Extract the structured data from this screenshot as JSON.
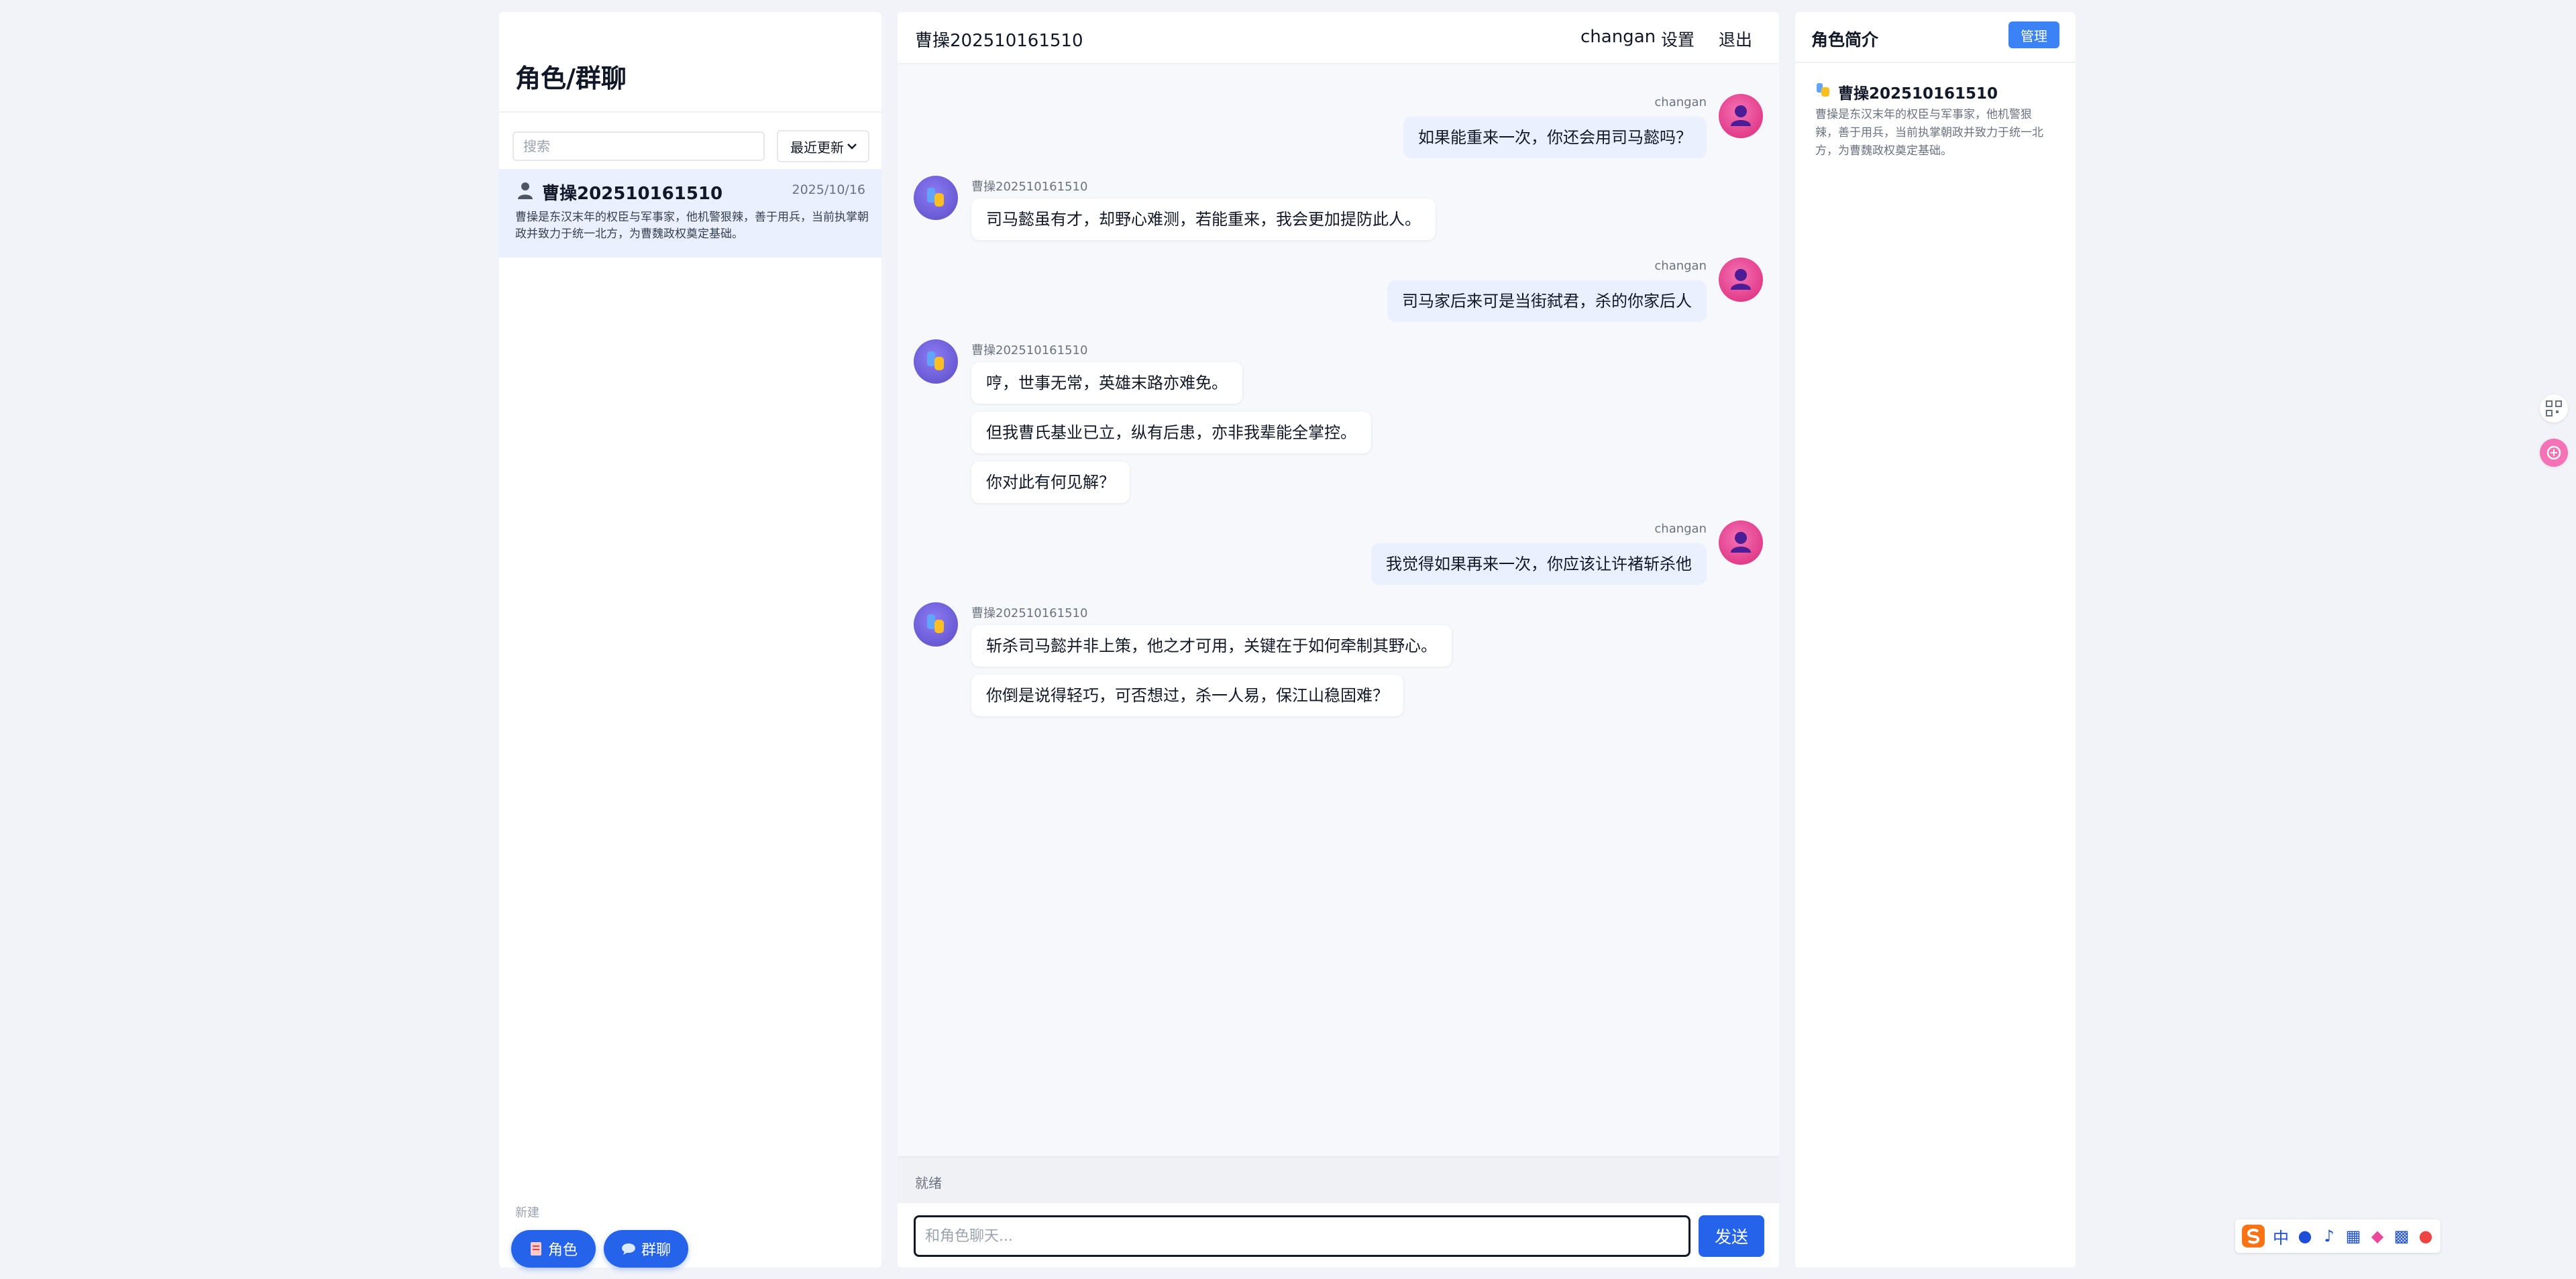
{
  "sidebar": {
    "title": "角色/群聊",
    "search_placeholder": "搜索",
    "sort_label": "最近更新",
    "conversations": [
      {
        "name": "曹操202510161510",
        "date": "2025/10/16",
        "desc": "曹操是东汉末年的权臣与军事家，他机警狠辣，善于用兵，当前执掌朝政并致力于统一北方，为曹魏政权奠定基础。"
      }
    ],
    "new_label": "新建",
    "new_role_label": "角色",
    "new_group_label": "群聊"
  },
  "chat": {
    "title": "曹操202510161510",
    "user": "changan",
    "settings_label": "设置",
    "logout_label": "退出",
    "messages": [
      {
        "sender": "changan",
        "role": "user",
        "texts": [
          "如果能重来一次，你还会用司马懿吗？"
        ]
      },
      {
        "sender": "曹操202510161510",
        "role": "bot",
        "texts": [
          "司马懿虽有才，却野心难测，若能重来，我会更加提防此人。"
        ]
      },
      {
        "sender": "changan",
        "role": "user",
        "texts": [
          "司马家后来可是当街弑君，杀的你家后人"
        ]
      },
      {
        "sender": "曹操202510161510",
        "role": "bot",
        "texts": [
          "哼，世事无常，英雄末路亦难免。",
          "但我曹氏基业已立，纵有后患，亦非我辈能全掌控。",
          "你对此有何见解？"
        ]
      },
      {
        "sender": "changan",
        "role": "user",
        "texts": [
          "我觉得如果再来一次，你应该让许褚斩杀他"
        ]
      },
      {
        "sender": "曹操202510161510",
        "role": "bot",
        "texts": [
          "斩杀司马懿并非上策，他之才可用，关键在于如何牵制其野心。",
          "你倒是说得轻巧，可否想过，杀一人易，保江山稳固难？"
        ]
      }
    ],
    "status": "就绪",
    "input_placeholder": "和角色聊天...",
    "send_label": "发送"
  },
  "profile": {
    "title": "角色简介",
    "manage_label": "管理",
    "name": "曹操202510161510",
    "desc": "曹操是东汉末年的权臣与军事家，他机警狠辣，善于用兵，当前执掌朝政并致力于统一北方，为曹魏政权奠定基础。"
  },
  "ime": {
    "items": [
      "中"
    ]
  },
  "colors": {
    "accent": "#2563eb",
    "user_bubble": "#eaf0fd",
    "user_avatar": "#db2777",
    "bot_avatar": "#5b4cc4"
  }
}
